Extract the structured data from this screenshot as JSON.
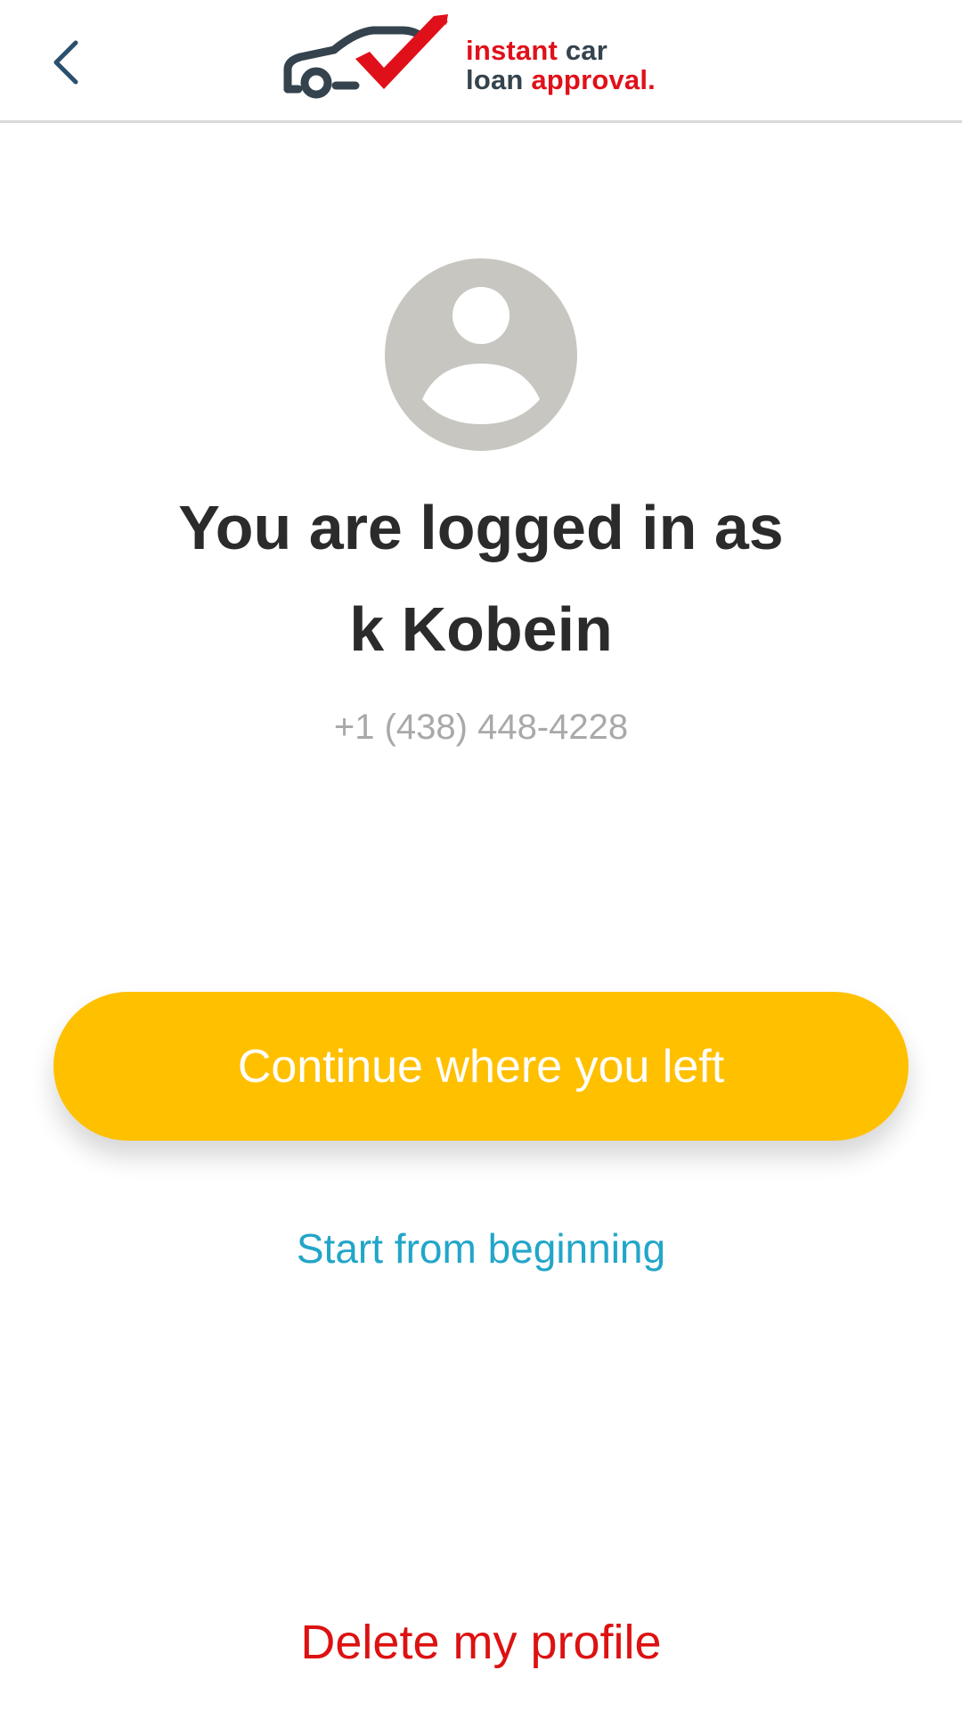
{
  "header": {
    "back_icon": "chevron-left-icon",
    "logo": {
      "line1_word1": "instant",
      "line1_word2": "car",
      "line2_word1": "loan",
      "line2_word2": "approval."
    }
  },
  "profile": {
    "avatar_icon": "user-avatar-icon",
    "title_line1": "You are logged in as",
    "title_line2": "k Kobein",
    "phone": "+1 (438) 448-4228"
  },
  "actions": {
    "continue_label": "Continue where you left",
    "start_label": "Start from beginning",
    "delete_label": "Delete my profile"
  },
  "colors": {
    "brand_red": "#e0101a",
    "brand_dark": "#34434d",
    "primary_button": "#ffc000",
    "link_blue": "#22a6c9",
    "danger_red": "#dd1111"
  }
}
